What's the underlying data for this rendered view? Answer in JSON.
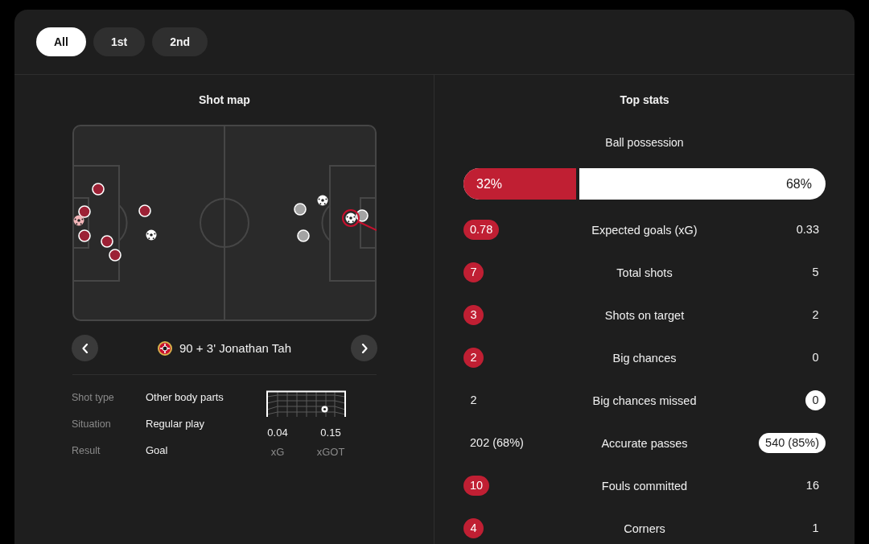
{
  "period_tabs": [
    {
      "label": "All",
      "selected": true
    },
    {
      "label": "1st",
      "selected": false
    },
    {
      "label": "2nd",
      "selected": false
    }
  ],
  "shot_map": {
    "title": "Shot map",
    "shots": [
      {
        "kind": "shot",
        "color": "#9c2135",
        "selected": false
      },
      {
        "kind": "shot",
        "color": "#9c2135",
        "selected": false
      },
      {
        "kind": "goal",
        "color": "#f2b5b8",
        "selected": false
      },
      {
        "kind": "shot",
        "color": "#9c2135",
        "selected": false
      },
      {
        "kind": "shot",
        "color": "#9c2135",
        "selected": false
      },
      {
        "kind": "shot",
        "color": "#9c2135",
        "selected": false
      },
      {
        "kind": "shot",
        "color": "#9c2135",
        "selected": false
      },
      {
        "kind": "goal",
        "color": "#ffffff",
        "selected": false
      },
      {
        "kind": "shot",
        "color": "#a3a3a3",
        "selected": false
      },
      {
        "kind": "goal",
        "color": "#ffffff",
        "selected": false
      },
      {
        "kind": "shot",
        "color": "#a3a3a3",
        "selected": false
      },
      {
        "kind": "shot",
        "color": "#a3a3a3",
        "selected": false
      },
      {
        "kind": "goal",
        "color": "#ffffff",
        "selected": true
      }
    ],
    "selected_shot": {
      "title": "90 + 3' Jonathan Tah",
      "details": [
        {
          "label": "Shot type",
          "value": "Other body parts"
        },
        {
          "label": "Situation",
          "value": "Regular play"
        },
        {
          "label": "Result",
          "value": "Goal"
        }
      ],
      "metrics": [
        {
          "value": "0.04",
          "label": "xG"
        },
        {
          "value": "0.15",
          "label": "xGOT"
        }
      ]
    }
  },
  "top_stats": {
    "title": "Top stats",
    "possession": {
      "label": "Ball possession",
      "home": "32%",
      "away": "68%",
      "level": 0.32
    },
    "rows": [
      {
        "label": "Expected goals (xG)",
        "home": "0.78",
        "away": "0.33",
        "home_highlighted": true,
        "away_highlighted": false
      },
      {
        "label": "Total shots",
        "home": "7",
        "away": "5",
        "home_highlighted": true,
        "away_highlighted": false
      },
      {
        "label": "Shots on target",
        "home": "3",
        "away": "2",
        "home_highlighted": true,
        "away_highlighted": false
      },
      {
        "label": "Big chances",
        "home": "2",
        "away": "0",
        "home_highlighted": true,
        "away_highlighted": false
      },
      {
        "label": "Big chances missed",
        "home": "2",
        "away": "0",
        "home_highlighted": false,
        "away_highlighted": true
      },
      {
        "label": "Accurate passes",
        "home": "202 (68%)",
        "away": "540 (85%)",
        "home_highlighted": false,
        "away_highlighted": true
      },
      {
        "label": "Fouls committed",
        "home": "10",
        "away": "16",
        "home_highlighted": true,
        "away_highlighted": false
      },
      {
        "label": "Corners",
        "home": "4",
        "away": "1",
        "home_highlighted": true,
        "away_highlighted": false
      }
    ]
  }
}
